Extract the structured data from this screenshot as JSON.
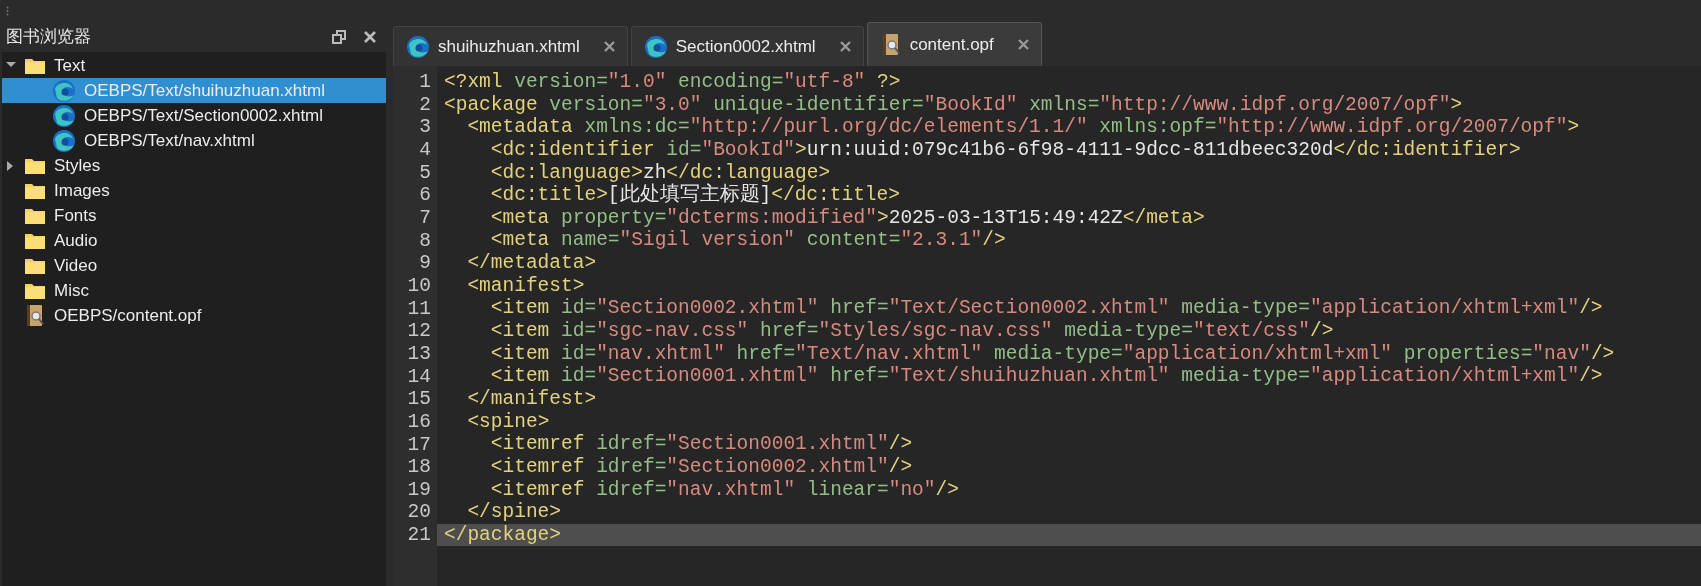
{
  "panel": {
    "title": "图书浏览器"
  },
  "tree": [
    {
      "label": "Text",
      "kind": "folder",
      "expanded": true,
      "selected": false,
      "children": [
        {
          "label": "OEBPS/Text/shuihuzhuan.xhtml",
          "kind": "xhtml",
          "selected": true
        },
        {
          "label": "OEBPS/Text/Section0002.xhtml",
          "kind": "xhtml",
          "selected": false
        },
        {
          "label": "OEBPS/Text/nav.xhtml",
          "kind": "xhtml",
          "selected": false
        }
      ]
    },
    {
      "label": "Styles",
      "kind": "folder",
      "expanded": false,
      "selected": false
    },
    {
      "label": "Images",
      "kind": "folder",
      "selected": false
    },
    {
      "label": "Fonts",
      "kind": "folder",
      "selected": false
    },
    {
      "label": "Audio",
      "kind": "folder",
      "selected": false
    },
    {
      "label": "Video",
      "kind": "folder",
      "selected": false
    },
    {
      "label": "Misc",
      "kind": "folder",
      "selected": false
    },
    {
      "label": "OEBPS/content.opf",
      "kind": "opf",
      "selected": false
    }
  ],
  "tabs": [
    {
      "label": "shuihuzhuan.xhtml",
      "kind": "xhtml",
      "selected": false
    },
    {
      "label": "Section0002.xhtml",
      "kind": "xhtml",
      "selected": false
    },
    {
      "label": "content.opf",
      "kind": "opf",
      "selected": true
    }
  ],
  "code_lines": [
    {
      "number": "1",
      "text": "<?xml version=\"1.0\" encoding=\"utf-8\" ?>",
      "current": false
    },
    {
      "number": "2",
      "text": "<package version=\"3.0\" unique-identifier=\"BookId\" xmlns=\"http://www.idpf.org/2007/opf\">",
      "current": false
    },
    {
      "number": "3",
      "text": "  <metadata xmlns:dc=\"http://purl.org/dc/elements/1.1/\" xmlns:opf=\"http://www.idpf.org/2007/opf\">",
      "current": false
    },
    {
      "number": "4",
      "text": "    <dc:identifier id=\"BookId\">urn:uuid:079c41b6-6f98-4111-9dcc-811dbeec320d</dc:identifier>",
      "current": false
    },
    {
      "number": "5",
      "text": "    <dc:language>zh</dc:language>",
      "current": false
    },
    {
      "number": "6",
      "text": "    <dc:title>[此处填写主标题]</dc:title>",
      "current": false
    },
    {
      "number": "7",
      "text": "    <meta property=\"dcterms:modified\">2025-03-13T15:49:42Z</meta>",
      "current": false
    },
    {
      "number": "8",
      "text": "    <meta name=\"Sigil version\" content=\"2.3.1\"/>",
      "current": false
    },
    {
      "number": "9",
      "text": "  </metadata>",
      "current": false
    },
    {
      "number": "10",
      "text": "  <manifest>",
      "current": false
    },
    {
      "number": "11",
      "text": "    <item id=\"Section0002.xhtml\" href=\"Text/Section0002.xhtml\" media-type=\"application/xhtml+xml\"/>",
      "current": false
    },
    {
      "number": "12",
      "text": "    <item id=\"sgc-nav.css\" href=\"Styles/sgc-nav.css\" media-type=\"text/css\"/>",
      "current": false
    },
    {
      "number": "13",
      "text": "    <item id=\"nav.xhtml\" href=\"Text/nav.xhtml\" media-type=\"application/xhtml+xml\" properties=\"nav\"/>",
      "current": false
    },
    {
      "number": "14",
      "text": "    <item id=\"Section0001.xhtml\" href=\"Text/shuihuzhuan.xhtml\" media-type=\"application/xhtml+xml\"/>",
      "current": false
    },
    {
      "number": "15",
      "text": "  </manifest>",
      "current": false
    },
    {
      "number": "16",
      "text": "  <spine>",
      "current": false
    },
    {
      "number": "17",
      "text": "    <itemref idref=\"Section0001.xhtml\"/>",
      "current": false
    },
    {
      "number": "18",
      "text": "    <itemref idref=\"Section0002.xhtml\"/>",
      "current": false
    },
    {
      "number": "19",
      "text": "    <itemref idref=\"nav.xhtml\" linear=\"no\"/>",
      "current": false
    },
    {
      "number": "20",
      "text": "  </spine>",
      "current": false
    },
    {
      "number": "21",
      "text": "</package>",
      "current": true
    }
  ]
}
